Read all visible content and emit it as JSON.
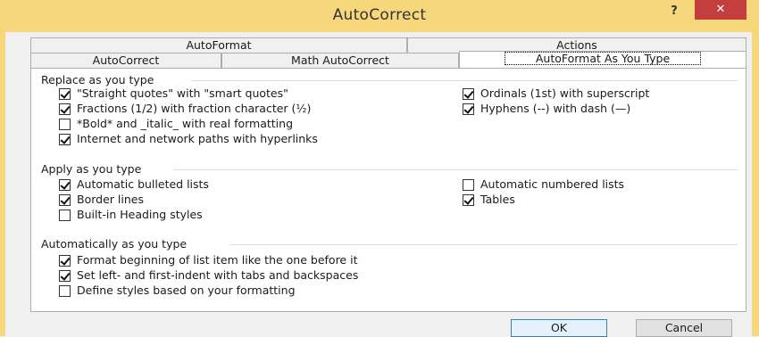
{
  "window": {
    "title": "AutoCorrect",
    "help_label": "?",
    "close_label": "✕"
  },
  "tabs_back": [
    {
      "label": "AutoFormat"
    },
    {
      "label": "Actions"
    }
  ],
  "tabs_front": [
    {
      "label": "AutoCorrect"
    },
    {
      "label": "Math AutoCorrect"
    },
    {
      "label": "AutoFormat As You Type"
    }
  ],
  "groups": {
    "replace": {
      "title": "Replace as you type",
      "left": [
        {
          "label": "\"Straight quotes\" with \"smart quotes\"",
          "checked": true
        },
        {
          "label": "Fractions (1/2) with fraction character (½)",
          "checked": true
        },
        {
          "label": "*Bold* and _italic_ with real formatting",
          "checked": false
        },
        {
          "label": "Internet and network paths with hyperlinks",
          "checked": true
        }
      ],
      "right": [
        {
          "label": "Ordinals (1st) with superscript",
          "checked": true
        },
        {
          "label": "Hyphens (--) with dash (—)",
          "checked": true
        }
      ]
    },
    "apply": {
      "title": "Apply as you type",
      "left": [
        {
          "label": "Automatic bulleted lists",
          "checked": true
        },
        {
          "label": "Border lines",
          "checked": true
        },
        {
          "label": "Built-in Heading styles",
          "checked": false
        }
      ],
      "right": [
        {
          "label": "Automatic numbered lists",
          "checked": false
        },
        {
          "label": "Tables",
          "checked": true
        }
      ]
    },
    "auto": {
      "title": "Automatically as you type",
      "left": [
        {
          "label": "Format beginning of list item like the one before it",
          "checked": true
        },
        {
          "label": "Set left- and first-indent with tabs and backspaces",
          "checked": true
        },
        {
          "label": "Define styles based on your formatting",
          "checked": false
        }
      ]
    }
  },
  "buttons": {
    "ok": "OK",
    "cancel": "Cancel"
  },
  "colors": {
    "titlebar": "#f7d77c",
    "close": "#c43e3e",
    "panel": "#ffffff"
  }
}
